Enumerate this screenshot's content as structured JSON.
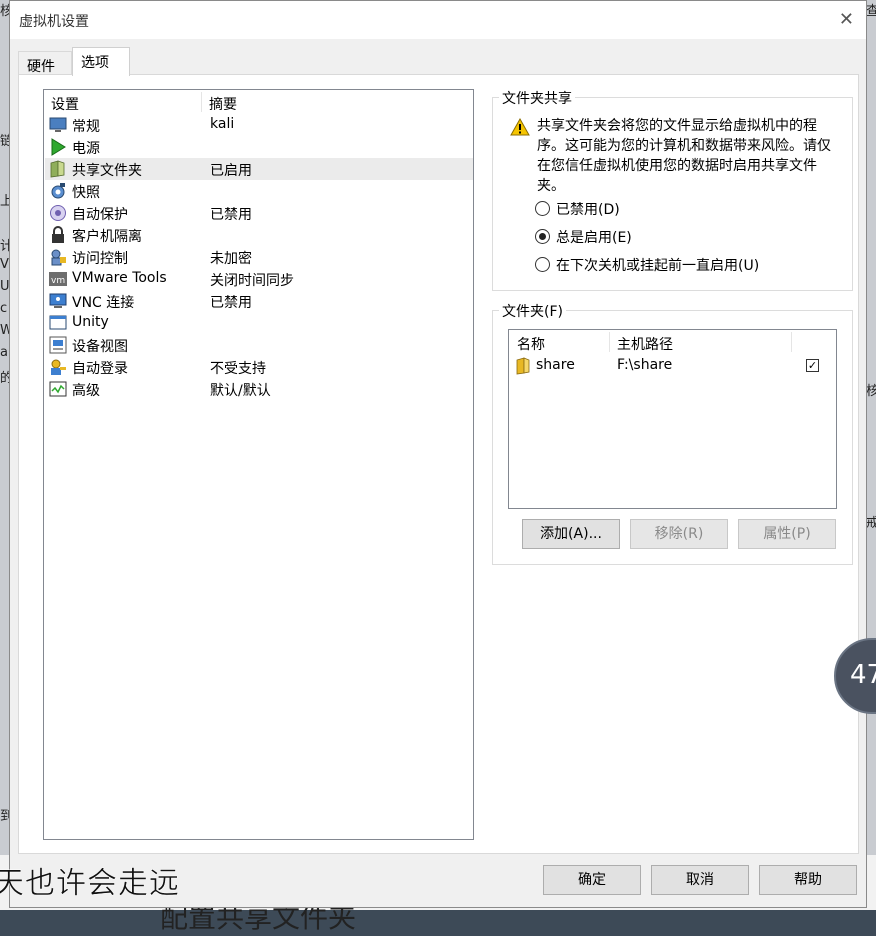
{
  "window": {
    "title": "虚拟机设置",
    "close_glyph": "✕"
  },
  "tabs": [
    {
      "label": "硬件",
      "active": false
    },
    {
      "label": "选项",
      "active": true
    }
  ],
  "list": {
    "header_setting": "设置",
    "header_summary": "摘要",
    "selected_index": 2,
    "items": [
      {
        "name": "常规",
        "summary": "kali",
        "icon": "monitor-icon"
      },
      {
        "name": "电源",
        "summary": "",
        "icon": "power-play-icon"
      },
      {
        "name": "共享文件夹",
        "summary": "已启用",
        "icon": "shared-folder-icon"
      },
      {
        "name": "快照",
        "summary": "",
        "icon": "snapshot-icon"
      },
      {
        "name": "自动保护",
        "summary": "已禁用",
        "icon": "autoprotect-icon"
      },
      {
        "name": "客户机隔离",
        "summary": "",
        "icon": "lock-icon"
      },
      {
        "name": "访问控制",
        "summary": "未加密",
        "icon": "access-control-icon"
      },
      {
        "name": "VMware Tools",
        "summary": "关闭时间同步",
        "icon": "vmware-tools-icon"
      },
      {
        "name": "VNC 连接",
        "summary": "已禁用",
        "icon": "vnc-icon"
      },
      {
        "name": "Unity",
        "summary": "",
        "icon": "unity-icon"
      },
      {
        "name": "设备视图",
        "summary": "",
        "icon": "device-view-icon"
      },
      {
        "name": "自动登录",
        "summary": "不受支持",
        "icon": "autologin-icon"
      },
      {
        "name": "高级",
        "summary": "默认/默认",
        "icon": "advanced-icon"
      }
    ]
  },
  "sharing": {
    "legend": "文件夹共享",
    "warning": "共享文件夹会将您的文件显示给虚拟机中的程序。这可能为您的计算机和数据带来风险。请仅在您信任虚拟机使用您的数据时启用共享文件夹。",
    "options": [
      {
        "label": "已禁用(D)",
        "checked": false
      },
      {
        "label": "总是启用(E)",
        "checked": true
      },
      {
        "label": "在下次关机或挂起前一直启用(U)",
        "checked": false
      }
    ]
  },
  "folders": {
    "legend": "文件夹(F)",
    "col_name": "名称",
    "col_path": "主机路径",
    "rows": [
      {
        "name": "share",
        "path": "F:\\share",
        "enabled": true,
        "check_glyph": "✓"
      }
    ],
    "add_label": "添加(A)...",
    "remove_label": "移除(R)",
    "properties_label": "属性(P)"
  },
  "footer": {
    "ok_label": "确定",
    "cancel_label": "取消",
    "help_label": "帮助"
  },
  "background": {
    "caption": "天也许会走远",
    "caption2": "配置共享文件夹",
    "bubble": "47"
  },
  "colors": {
    "accent_warning": "#f5c400",
    "selected_row": "#ebebeb"
  }
}
